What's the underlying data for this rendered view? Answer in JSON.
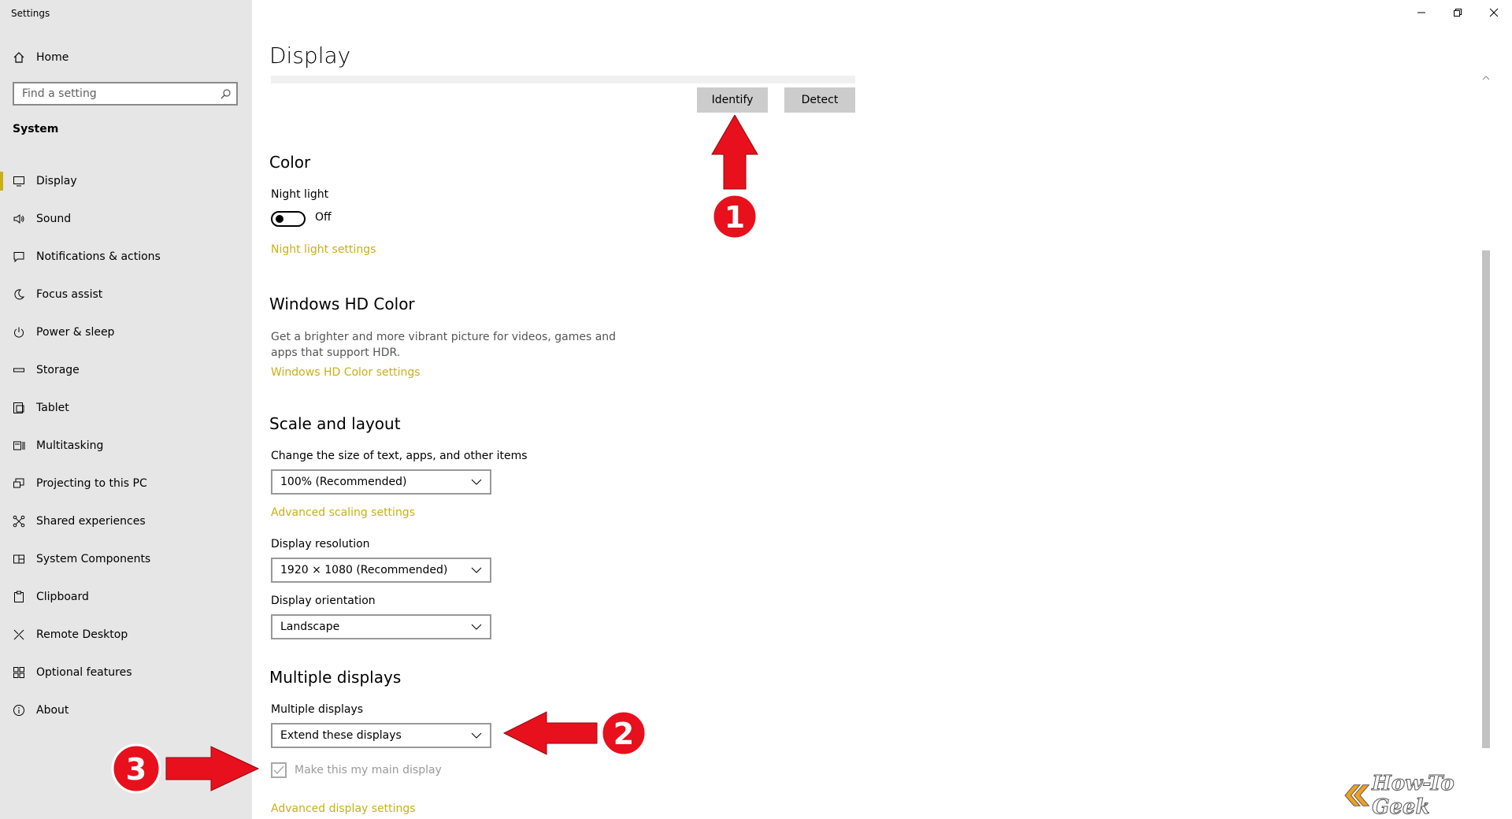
{
  "app": {
    "title": "Settings"
  },
  "sidebar": {
    "home_label": "Home",
    "search_placeholder": "Find a setting",
    "section_label": "System",
    "items": [
      {
        "label": "Display",
        "icon": "monitor-icon",
        "active": true
      },
      {
        "label": "Sound",
        "icon": "speaker-icon"
      },
      {
        "label": "Notifications & actions",
        "icon": "notifications-icon"
      },
      {
        "label": "Focus assist",
        "icon": "moon-icon"
      },
      {
        "label": "Power & sleep",
        "icon": "power-icon"
      },
      {
        "label": "Storage",
        "icon": "storage-icon"
      },
      {
        "label": "Tablet",
        "icon": "tablet-icon"
      },
      {
        "label": "Multitasking",
        "icon": "multitasking-icon"
      },
      {
        "label": "Projecting to this PC",
        "icon": "projecting-icon"
      },
      {
        "label": "Shared experiences",
        "icon": "shared-icon"
      },
      {
        "label": "System Components",
        "icon": "components-icon"
      },
      {
        "label": "Clipboard",
        "icon": "clipboard-icon"
      },
      {
        "label": "Remote Desktop",
        "icon": "remote-icon"
      },
      {
        "label": "Optional features",
        "icon": "features-icon"
      },
      {
        "label": "About",
        "icon": "info-icon"
      }
    ]
  },
  "main": {
    "title": "Display",
    "identify_label": "Identify",
    "detect_label": "Detect",
    "color": {
      "heading": "Color",
      "night_light_label": "Night light",
      "night_light_state": "Off",
      "night_light_link": "Night light settings"
    },
    "hdr": {
      "heading": "Windows HD Color",
      "description": "Get a brighter and more vibrant picture for videos, games and apps that support HDR.",
      "link": "Windows HD Color settings"
    },
    "scale": {
      "heading": "Scale and layout",
      "size_label": "Change the size of text, apps, and other items",
      "size_value": "100% (Recommended)",
      "advanced_link": "Advanced scaling settings",
      "resolution_label": "Display resolution",
      "resolution_value": "1920 × 1080 (Recommended)",
      "orientation_label": "Display orientation",
      "orientation_value": "Landscape"
    },
    "multiple": {
      "heading": "Multiple displays",
      "label": "Multiple displays",
      "value": "Extend these displays",
      "main_display_label": "Make this my main display",
      "main_display_checked": true,
      "advanced_link": "Advanced display settings"
    }
  },
  "annotations": {
    "badge_1": "1",
    "badge_2": "2",
    "badge_3": "3"
  },
  "watermark": {
    "text": "How-To Geek"
  },
  "colors": {
    "accent": "#c9b014",
    "arrow": "#e8101c",
    "sidebar_bg": "#e6e6e6",
    "button_bg": "#cccccc"
  }
}
